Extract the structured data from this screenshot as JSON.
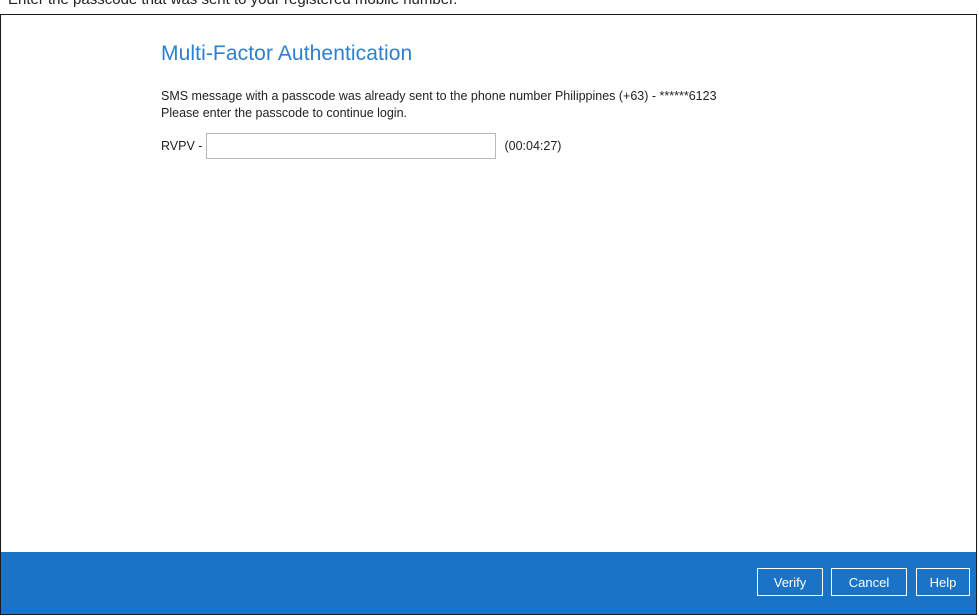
{
  "top_strip": {
    "cut_text": "Enter the passcode that was sent to your registered mobile number."
  },
  "dialog": {
    "title": "Multi-Factor Authentication",
    "message_line1": "SMS message with a passcode was already sent to the phone number Philippines (+63) - ******6123",
    "message_line2": "Please enter the passcode to continue login.",
    "passcode_prefix": "RVPV -",
    "passcode_value": "",
    "passcode_placeholder": "",
    "countdown": "(00:04:27)"
  },
  "footer": {
    "verify_label": "Verify",
    "cancel_label": "Cancel",
    "help_label": "Help",
    "background_color": "#1a73c7"
  },
  "colors": {
    "title": "#2d7fd0"
  }
}
